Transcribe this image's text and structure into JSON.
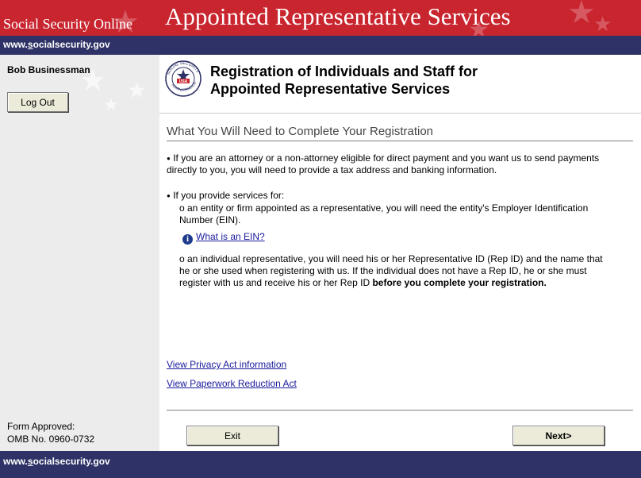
{
  "header": {
    "site_name": "Social Security Online",
    "app_title": "Appointed Representative Services"
  },
  "urlbar": {
    "prefix": "www.",
    "underlined": "s",
    "suffix": "ocialsecurity.gov"
  },
  "sidebar": {
    "user_name": "Bob Businessman",
    "logout_label": "Log Out",
    "form_approved": "Form Approved:",
    "omb_number": "OMB No. 0960-0732"
  },
  "main": {
    "title_line1": "Registration of Individuals and Staff for",
    "title_line2": "Appointed Representative Services",
    "section_heading": "What You Will Need to Complete Your Registration",
    "para1": "If you are an attorney or a non-attorney eligible for direct payment and you want us to send payments directly to you, you will need to provide a tax address and banking information.",
    "para2": "If you provide services for:",
    "sub1": "o an entity or firm appointed as a representative, you will need the entity's Employer Identification Number (EIN).",
    "ein_link": "What is an EIN?",
    "sub2_text": "o an individual representative, you will need his or her Representative ID (Rep ID) and the name that he or she used when registering with us. If the individual does not have a Rep ID, he or she must register with us and receive his or her Rep ID ",
    "sub2_bold": "before you complete your registration.",
    "privacy_link": "View Privacy Act information",
    "paperwork_link": "View Paperwork Reduction Act",
    "exit_label": "Exit",
    "next_label": "Next>"
  },
  "logo": {
    "text_top": "SOCIAL SECURITY",
    "text_bottom": "ADMINISTRATION",
    "center": "USA"
  },
  "colors": {
    "banner_red": "#c8252f",
    "navy": "#2e3266",
    "sidebar_gray": "#ececec",
    "link_blue": "#1a1a9c"
  }
}
